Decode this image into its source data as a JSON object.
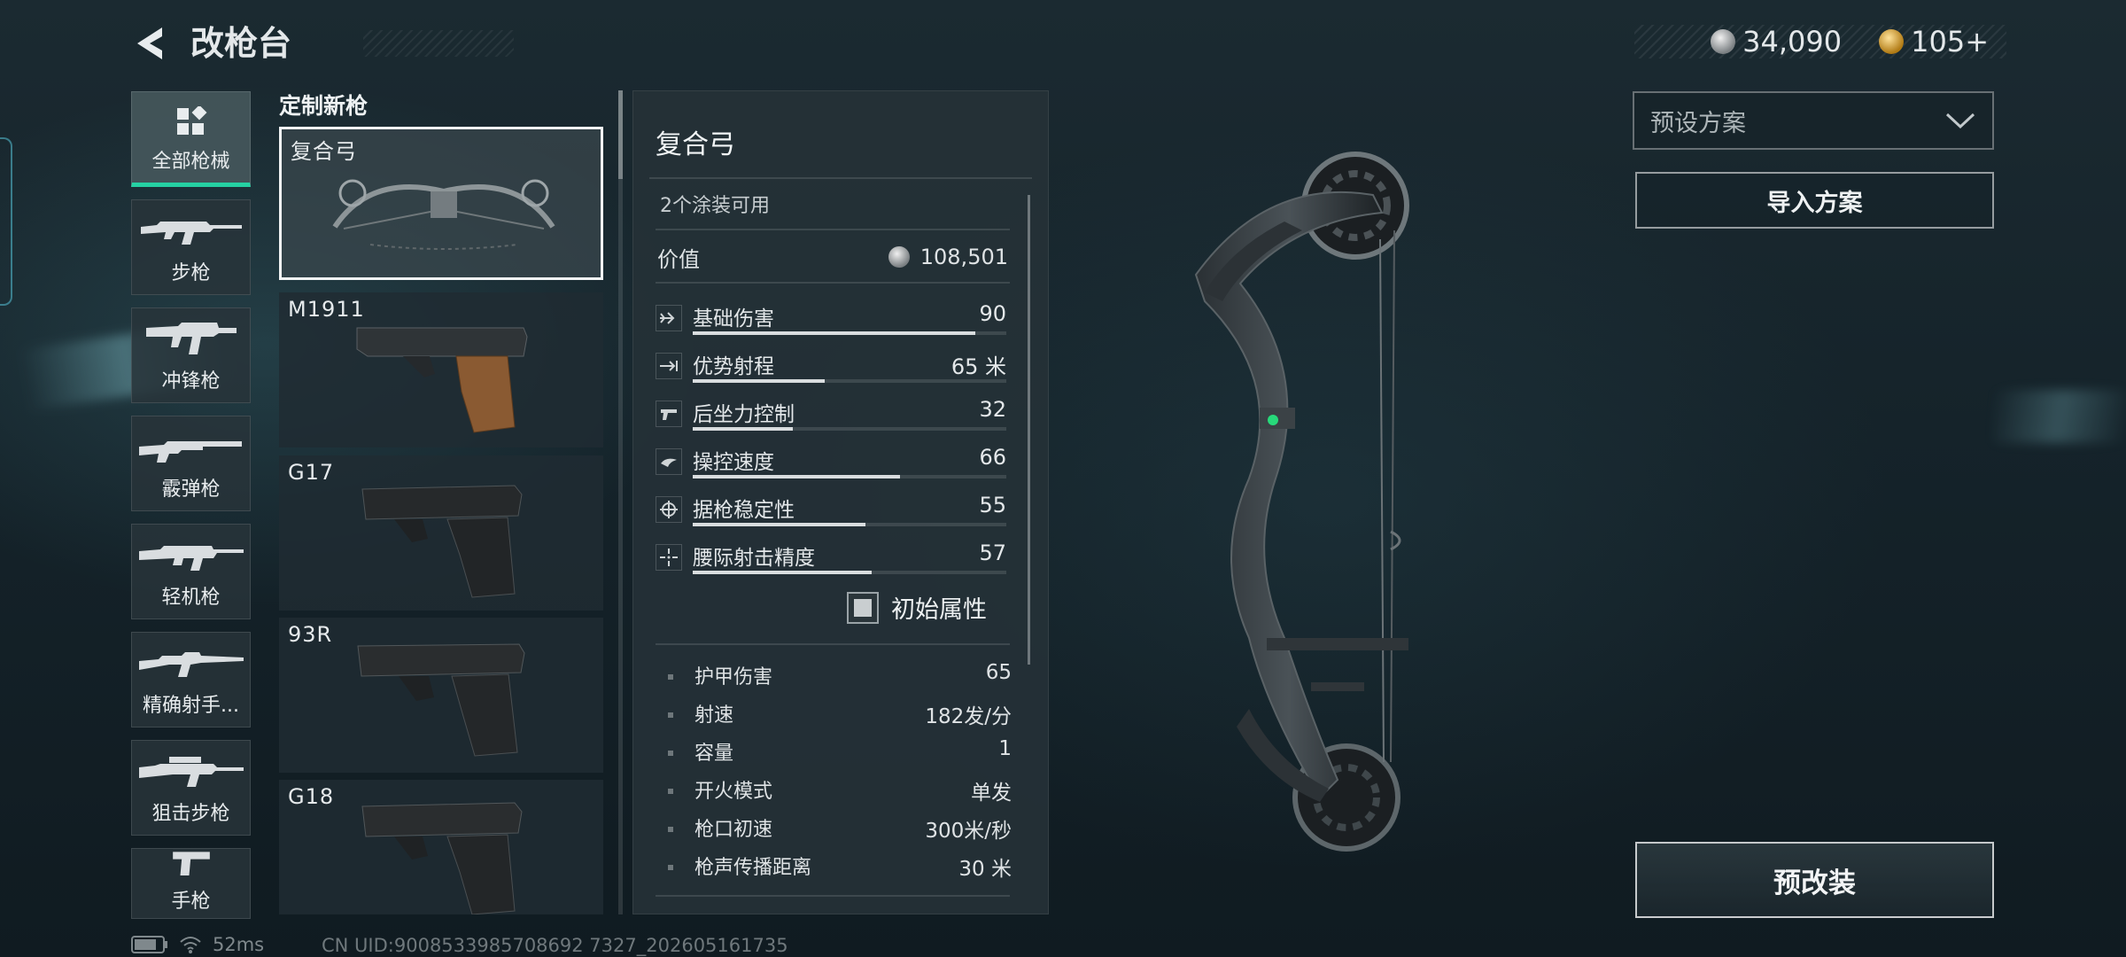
{
  "header": {
    "title": "改枪台",
    "currencies": [
      {
        "icon": "silver-coin-icon",
        "value": "34,090"
      },
      {
        "icon": "gold-coin-icon",
        "value": "105+"
      }
    ]
  },
  "categories": [
    {
      "label": "全部枪械",
      "icon": "all-weapons-icon",
      "active": true
    },
    {
      "label": "步枪",
      "icon": "rifle-icon"
    },
    {
      "label": "冲锋枪",
      "icon": "smg-icon"
    },
    {
      "label": "霰弹枪",
      "icon": "shotgun-icon"
    },
    {
      "label": "轻机枪",
      "icon": "lmg-icon"
    },
    {
      "label": "精确射手...",
      "icon": "marksman-rifle-icon"
    },
    {
      "label": "狙击步枪",
      "icon": "sniper-rifle-icon"
    },
    {
      "label": "手枪",
      "icon": "pistol-icon"
    }
  ],
  "weapon_list": {
    "title": "定制新枪",
    "items": [
      {
        "name": "复合弓",
        "selected": true
      },
      {
        "name": "M1911"
      },
      {
        "name": "G17"
      },
      {
        "name": "93R"
      },
      {
        "name": "G18"
      }
    ]
  },
  "details": {
    "weapon_name": "复合弓",
    "skins": "2个涂装可用",
    "value_label": "价值",
    "value": "108,501",
    "stats": [
      {
        "name": "基础伤害",
        "value": "90",
        "level": 0.9
      },
      {
        "name": "优势射程",
        "value": "65 米",
        "level": 0.42
      },
      {
        "name": "后坐力控制",
        "value": "32",
        "level": 0.32
      },
      {
        "name": "操控速度",
        "value": "66",
        "level": 0.66
      },
      {
        "name": "据枪稳定性",
        "value": "55",
        "level": 0.55
      },
      {
        "name": "腰际射击精度",
        "value": "57",
        "level": 0.57
      }
    ],
    "initial_attr_label": "初始属性",
    "attributes": [
      {
        "name": "护甲伤害",
        "value": "65"
      },
      {
        "name": "射速",
        "value": "182发/分"
      },
      {
        "name": "容量",
        "value": "1"
      },
      {
        "name": "开火模式",
        "value": "单发"
      },
      {
        "name": "枪口初速",
        "value": "300米/秒"
      },
      {
        "name": "枪声传播距离",
        "value": "30 米"
      }
    ]
  },
  "right_panel": {
    "preset_placeholder": "预设方案",
    "import_label": "导入方案",
    "premod_label": "预改装"
  },
  "footer": {
    "ping": "52ms",
    "uid": "CN UID:9008533985708692 7327_202605161735"
  }
}
